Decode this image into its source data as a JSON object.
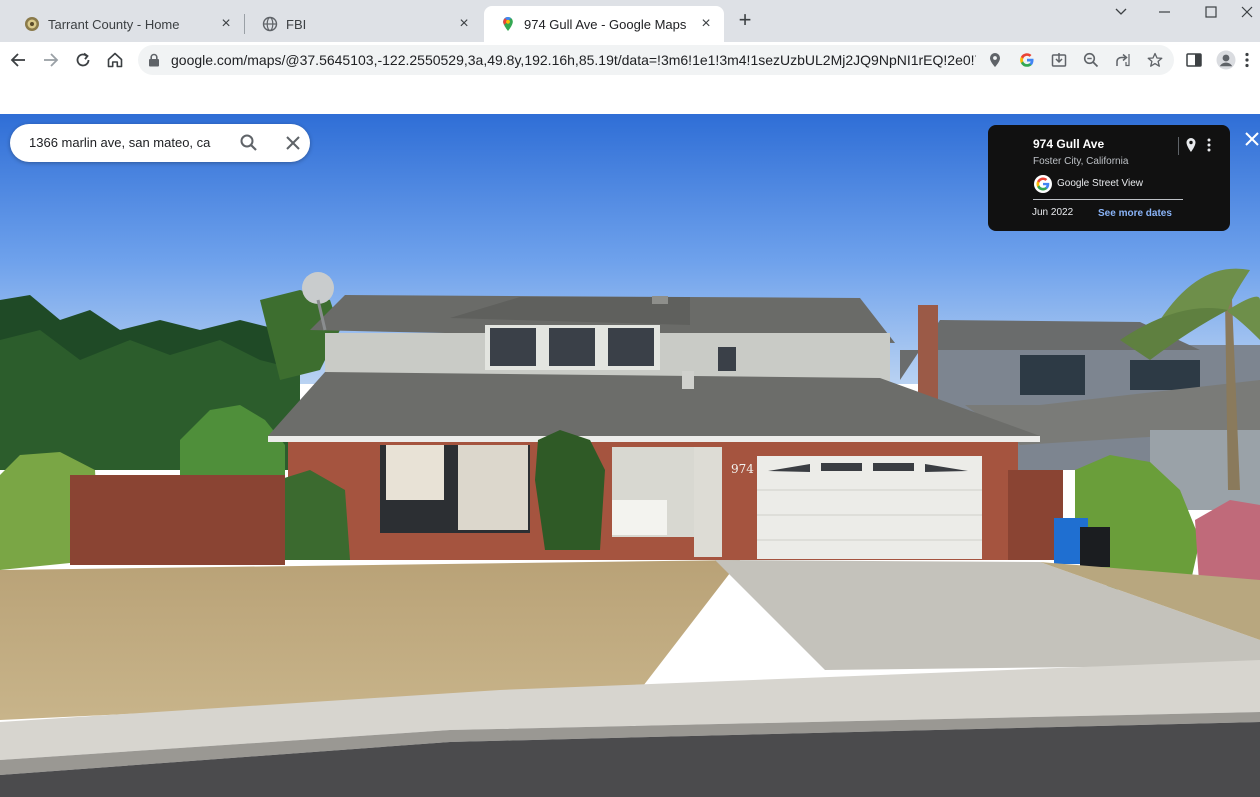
{
  "tabs": [
    {
      "title": "Tarrant County - Home",
      "icon": "county-seal-icon"
    },
    {
      "title": "FBI",
      "icon": "globe-icon"
    },
    {
      "title": "974 Gull Ave - Google Maps",
      "icon": "google-maps-icon",
      "active": true
    }
  ],
  "address_bar": {
    "url": "google.com/maps/@37.5645103,-122.2550529,3a,49.8y,192.16h,85.19t/data=!3m6!1e1!3m4!1sezUzbUL2Mj2JQ9NpNI1rEQ!2e0!7..."
  },
  "maps_search": {
    "value": "1366 marlin ave, san mateo, ca"
  },
  "street_view_card": {
    "address": "974 Gull Ave",
    "city": "Foster City, California",
    "source": "Google Street View",
    "date": "Jun 2022",
    "see_more": "See more dates"
  },
  "house_number": "974",
  "colors": {
    "tabstrip": "#dee1e6",
    "google_blue": "#4285f4",
    "google_red": "#ea4335",
    "google_yellow": "#fbbc05",
    "google_green": "#34a853",
    "link": "#8ab4f8"
  }
}
